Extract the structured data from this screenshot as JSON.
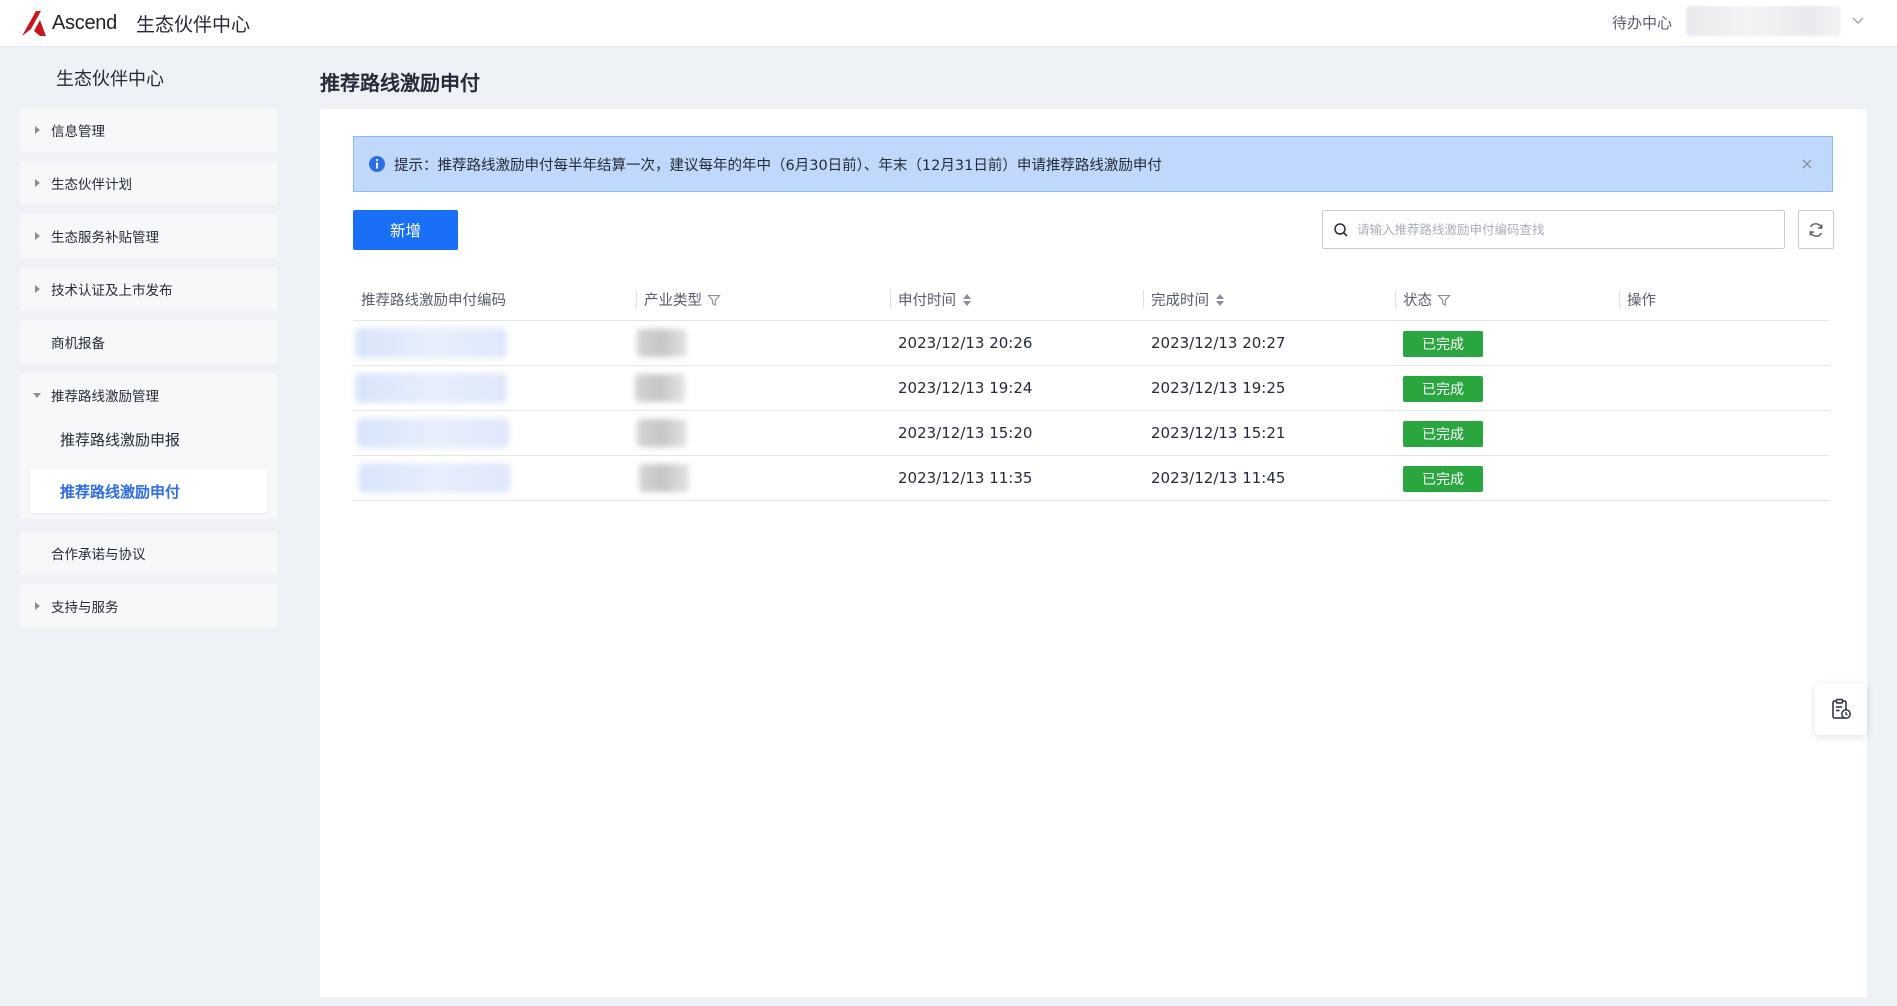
{
  "header": {
    "logo_text": "Ascend",
    "app_title": "生态伙伴中心",
    "todo_label": "待办中心"
  },
  "sidebar": {
    "title": "生态伙伴中心",
    "items": [
      {
        "label": "信息管理"
      },
      {
        "label": "生态伙伴计划"
      },
      {
        "label": "生态服务补贴管理"
      },
      {
        "label": "技术认证及上市发布"
      },
      {
        "label": "商机报备"
      },
      {
        "label": "推荐路线激励管理"
      },
      {
        "label": "合作承诺与协议"
      },
      {
        "label": "支持与服务"
      }
    ],
    "sub_items": [
      {
        "label": "推荐路线激励申报"
      },
      {
        "label": "推荐路线激励申付",
        "active": true
      }
    ]
  },
  "main": {
    "page_title": "推荐路线激励申付",
    "alert_text": "提示：推荐路线激励申付每半年结算一次，建议每年的年中（6月30日前）、年末（12月31日前）申请推荐路线激励申付",
    "add_button": "新增",
    "search_placeholder": "请输入推荐路线激励申付编码查找",
    "columns": [
      "推荐路线激励申付编码",
      "产业类型",
      "申付时间",
      "完成时间",
      "状态",
      "操作"
    ],
    "rows": [
      {
        "apply_time": "2023/12/13 20:26",
        "done_time": "2023/12/13 20:27",
        "status": "已完成"
      },
      {
        "apply_time": "2023/12/13 19:24",
        "done_time": "2023/12/13 19:25",
        "status": "已完成"
      },
      {
        "apply_time": "2023/12/13 15:20",
        "done_time": "2023/12/13 15:21",
        "status": "已完成"
      },
      {
        "apply_time": "2023/12/13 11:35",
        "done_time": "2023/12/13 11:45",
        "status": "已完成"
      }
    ]
  },
  "colors": {
    "primary": "#1a6ff7",
    "status_done": "#2aa63f",
    "alert_bg": "#bfd8fb",
    "active_nav": "#2d6de6",
    "logo_red": "#c7161e"
  }
}
